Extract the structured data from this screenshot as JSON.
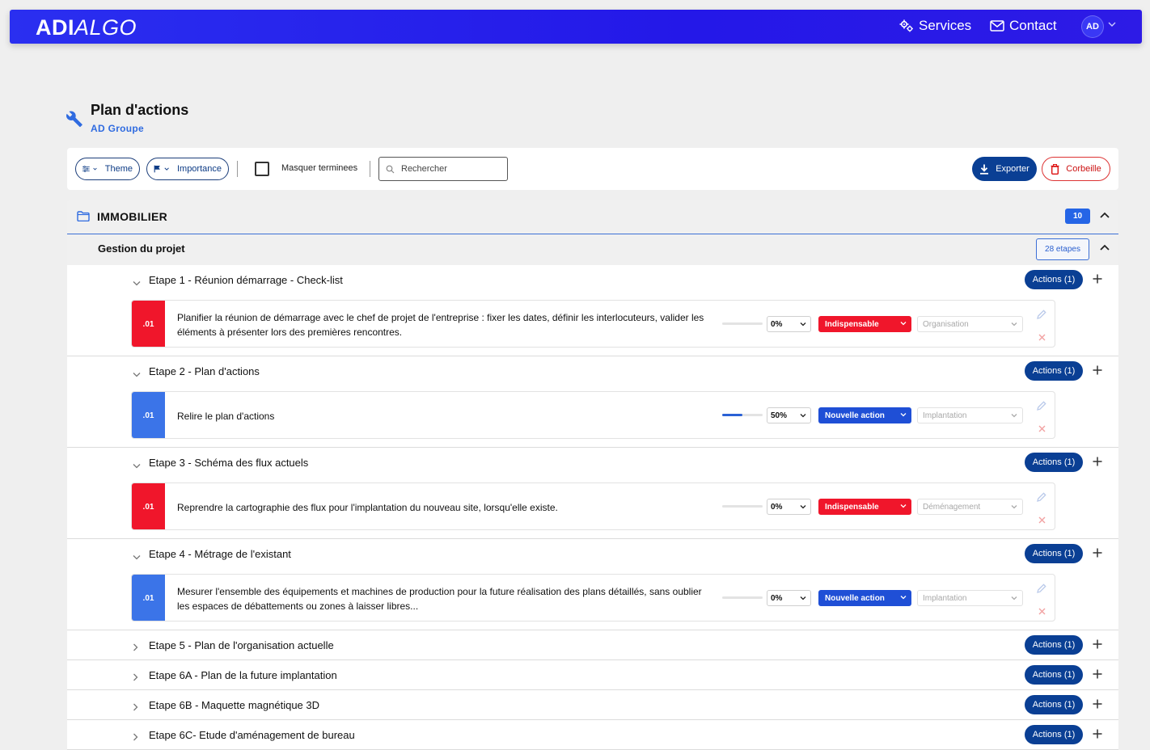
{
  "topbar": {
    "logo_bold": "ADI",
    "logo_italic": "ALGO",
    "services": "Services",
    "contact": "Contact",
    "avatar": "AD"
  },
  "page": {
    "title": "Plan d'actions",
    "subtitle": "AD Groupe"
  },
  "toolbar": {
    "theme": "Theme",
    "importance": "Importance",
    "hide_done": "Masquer terminees",
    "search_placeholder": "Rechercher",
    "export": "Exporter",
    "trash": "Corbeille"
  },
  "group": {
    "title": "IMMOBILIER",
    "count": "10"
  },
  "subgroup": {
    "title": "Gestion du projet",
    "etapes": "28 etapes"
  },
  "steps": [
    {
      "title": "Etape 1 - Réunion démarrage - Check-list",
      "actions": "Actions (1)",
      "card": {
        "num": ".01",
        "text": "Planifier la réunion de démarrage avec le chef de projet de l'entreprise : fixer les dates, définir les interlocuteurs, valider les éléments à présenter lors des premières rencontres.",
        "progress": "0%",
        "importance": "Indispensable",
        "theme": "Organisation"
      }
    },
    {
      "title": "Etape 2 - Plan d'actions",
      "actions": "Actions (1)",
      "card": {
        "num": ".01",
        "text": "Relire le plan d'actions",
        "progress": "50%",
        "importance": "Nouvelle action",
        "theme": "Implantation"
      }
    },
    {
      "title": "Etape 3 - Schéma des flux actuels",
      "actions": "Actions (1)",
      "card": {
        "num": ".01",
        "text": "Reprendre la cartographie des flux pour l'implantation du nouveau site, lorsqu'elle existe.",
        "progress": "0%",
        "importance": "Indispensable",
        "theme": "Déménagement"
      }
    },
    {
      "title": "Etape 4 - Métrage de l'existant",
      "actions": "Actions (1)",
      "card": {
        "num": ".01",
        "text": "Mesurer l'ensemble des équipements et machines de production pour la future réalisation des plans détaillés, sans oublier les espaces de débattements ou zones à laisser libres...",
        "progress": "0%",
        "importance": "Nouvelle action",
        "theme": "Implantation"
      }
    },
    {
      "title": "Etape 5 - Plan de l'organisation actuelle",
      "actions": "Actions (1)"
    },
    {
      "title": "Etape 6A - Plan de la future implantation",
      "actions": "Actions (1)"
    },
    {
      "title": "Etape 6B - Maquette magnétique 3D",
      "actions": "Actions (1)"
    },
    {
      "title": "Etape 6C- Etude d'aménagement de bureau",
      "actions": "Actions (1)"
    }
  ],
  "colors": {
    "indispensable": "#f0162b",
    "nouvelle_action": "#1f4fd6",
    "num_red": "#f0162b",
    "num_blue": "#3b74e8"
  }
}
